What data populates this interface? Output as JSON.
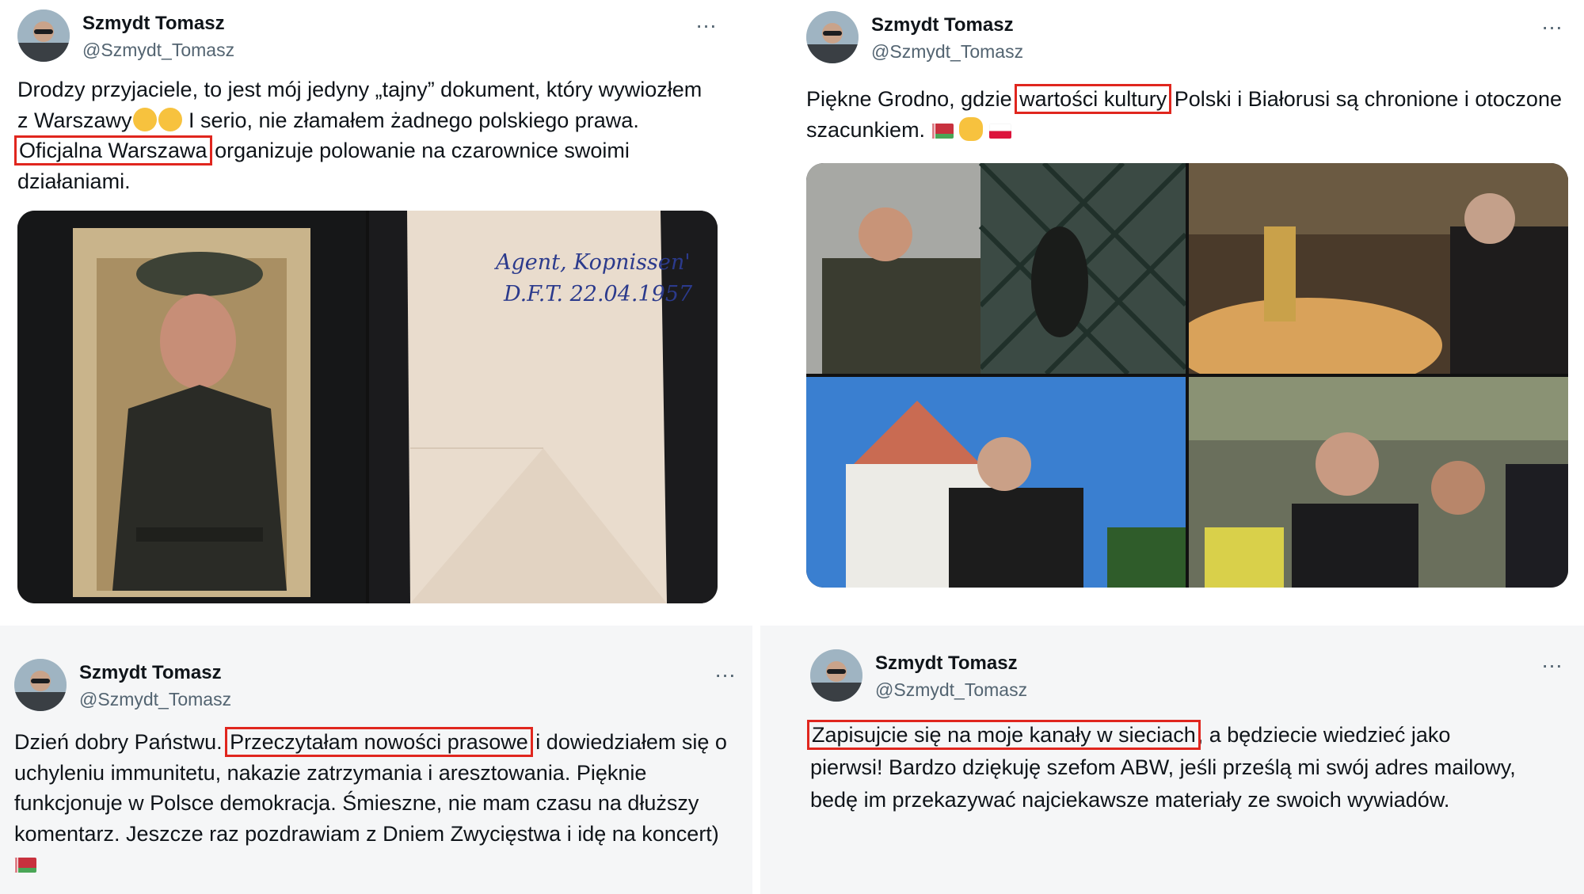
{
  "colors": {
    "highlight": "#e0261e",
    "text": "#0f1419",
    "secondary": "#536471"
  },
  "tweets": [
    {
      "author": "Szmydt Tomasz",
      "handle": "@Szmydt_Tomasz",
      "more_icon": "…",
      "text": {
        "p1": "Drodzy przyjaciele, to jest mój jedyny „tajny” dokument, który wywiozłem z Warszawy",
        "p2": " I serio, nie złamałem żadnego polskiego prawa. ",
        "highlight": "Oficjalna Warszawa",
        "p3": " organizuje polowanie na czarownice swoimi działaniami."
      },
      "emoji": [
        "rolling-on-floor-laughing",
        "rolling-on-floor-laughing"
      ],
      "images": [
        "portrait-photo",
        "handwritten-note"
      ],
      "note": {
        "line1": "Agent, Kopnissen'",
        "line2": "D.F.T. 22.04.1957"
      }
    },
    {
      "author": "Szmydt Tomasz",
      "handle": "@Szmydt_Tomasz",
      "more_icon": "…",
      "text": {
        "p1": "Piękne Grodno, gdzie ",
        "highlight": "wartości kultury",
        "p2": " Polski i Białorusi są chronione i otoczone szacunkiem. "
      },
      "emoji": [
        "flag-belarus",
        "handshake",
        "flag-poland"
      ],
      "images": [
        "gate-photo",
        "church-candles-photo",
        "castle-photo",
        "crowd-photo"
      ]
    },
    {
      "author": "Szmydt Tomasz",
      "handle": "@Szmydt_Tomasz",
      "more_icon": "…",
      "text": {
        "p1": "Dzień dobry Państwu. ",
        "highlight": "Przeczytałam nowości prasowe",
        "p2": " i dowiedziałem się o uchyleniu immunitetu, nakazie zatrzymania i aresztowania. Pięknie funkcjonuje w Polsce demokracja. Śmieszne, nie mam czasu na dłuższy komentarz. Jeszcze raz pozdrawiam z Dniem Zwycięstwa i idę na koncert) "
      },
      "emoji": [
        "flag-belarus"
      ]
    },
    {
      "author": "Szmydt Tomasz",
      "handle": "@Szmydt_Tomasz",
      "more_icon": "…",
      "text": {
        "highlight": "Zapisujcie się na moje kanały w sieciach",
        "p1": ", a będziecie wiedzieć jako pierwsi! Bardzo dziękuję szefom ABW, jeśli prześlą mi swój adres mailowy, bedę im przekazywać najciekawsze materiały ze swoich wywiadów."
      }
    }
  ]
}
